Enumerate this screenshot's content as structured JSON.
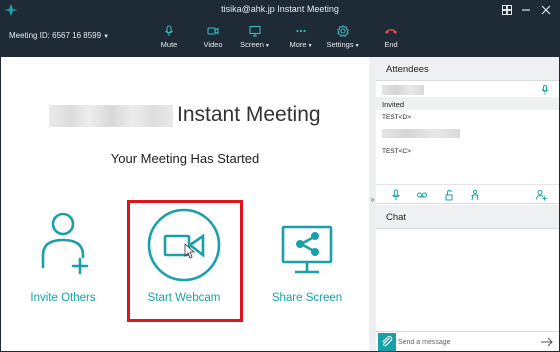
{
  "window": {
    "title": "tisika@ahk.jp Instant Meeting"
  },
  "toolbar": {
    "meeting_id": "Meeting ID: 6567 16 8599",
    "items": [
      {
        "label": "Mute",
        "icon": "microphone-icon"
      },
      {
        "label": "Video",
        "icon": "video-camera-icon"
      },
      {
        "label": "Screen",
        "icon": "screen-share-icon"
      },
      {
        "label": "More",
        "icon": "more-dots-icon"
      },
      {
        "label": "Settings",
        "icon": "gear-icon"
      },
      {
        "label": "End",
        "icon": "phone-hangup-icon"
      }
    ]
  },
  "main": {
    "title": "Instant Meeting",
    "subtitle": "Your Meeting Has Started",
    "actions": [
      {
        "label": "Invite Others",
        "icon": "add-user-icon"
      },
      {
        "label": "Start Webcam",
        "icon": "webcam-icon"
      },
      {
        "label": "Share Screen",
        "icon": "share-screen-icon"
      }
    ]
  },
  "attendees": {
    "title": "Attendees",
    "invited_label": "Invited",
    "entries": [
      "TEST<D>",
      "TEST<C>"
    ]
  },
  "chat": {
    "title": "Chat",
    "input_placeholder": "Send a message"
  },
  "colors": {
    "accent": "#1aa0a9",
    "highlight": "#e0141b",
    "titlebar": "#1e2b36",
    "end_call": "#e05454"
  }
}
